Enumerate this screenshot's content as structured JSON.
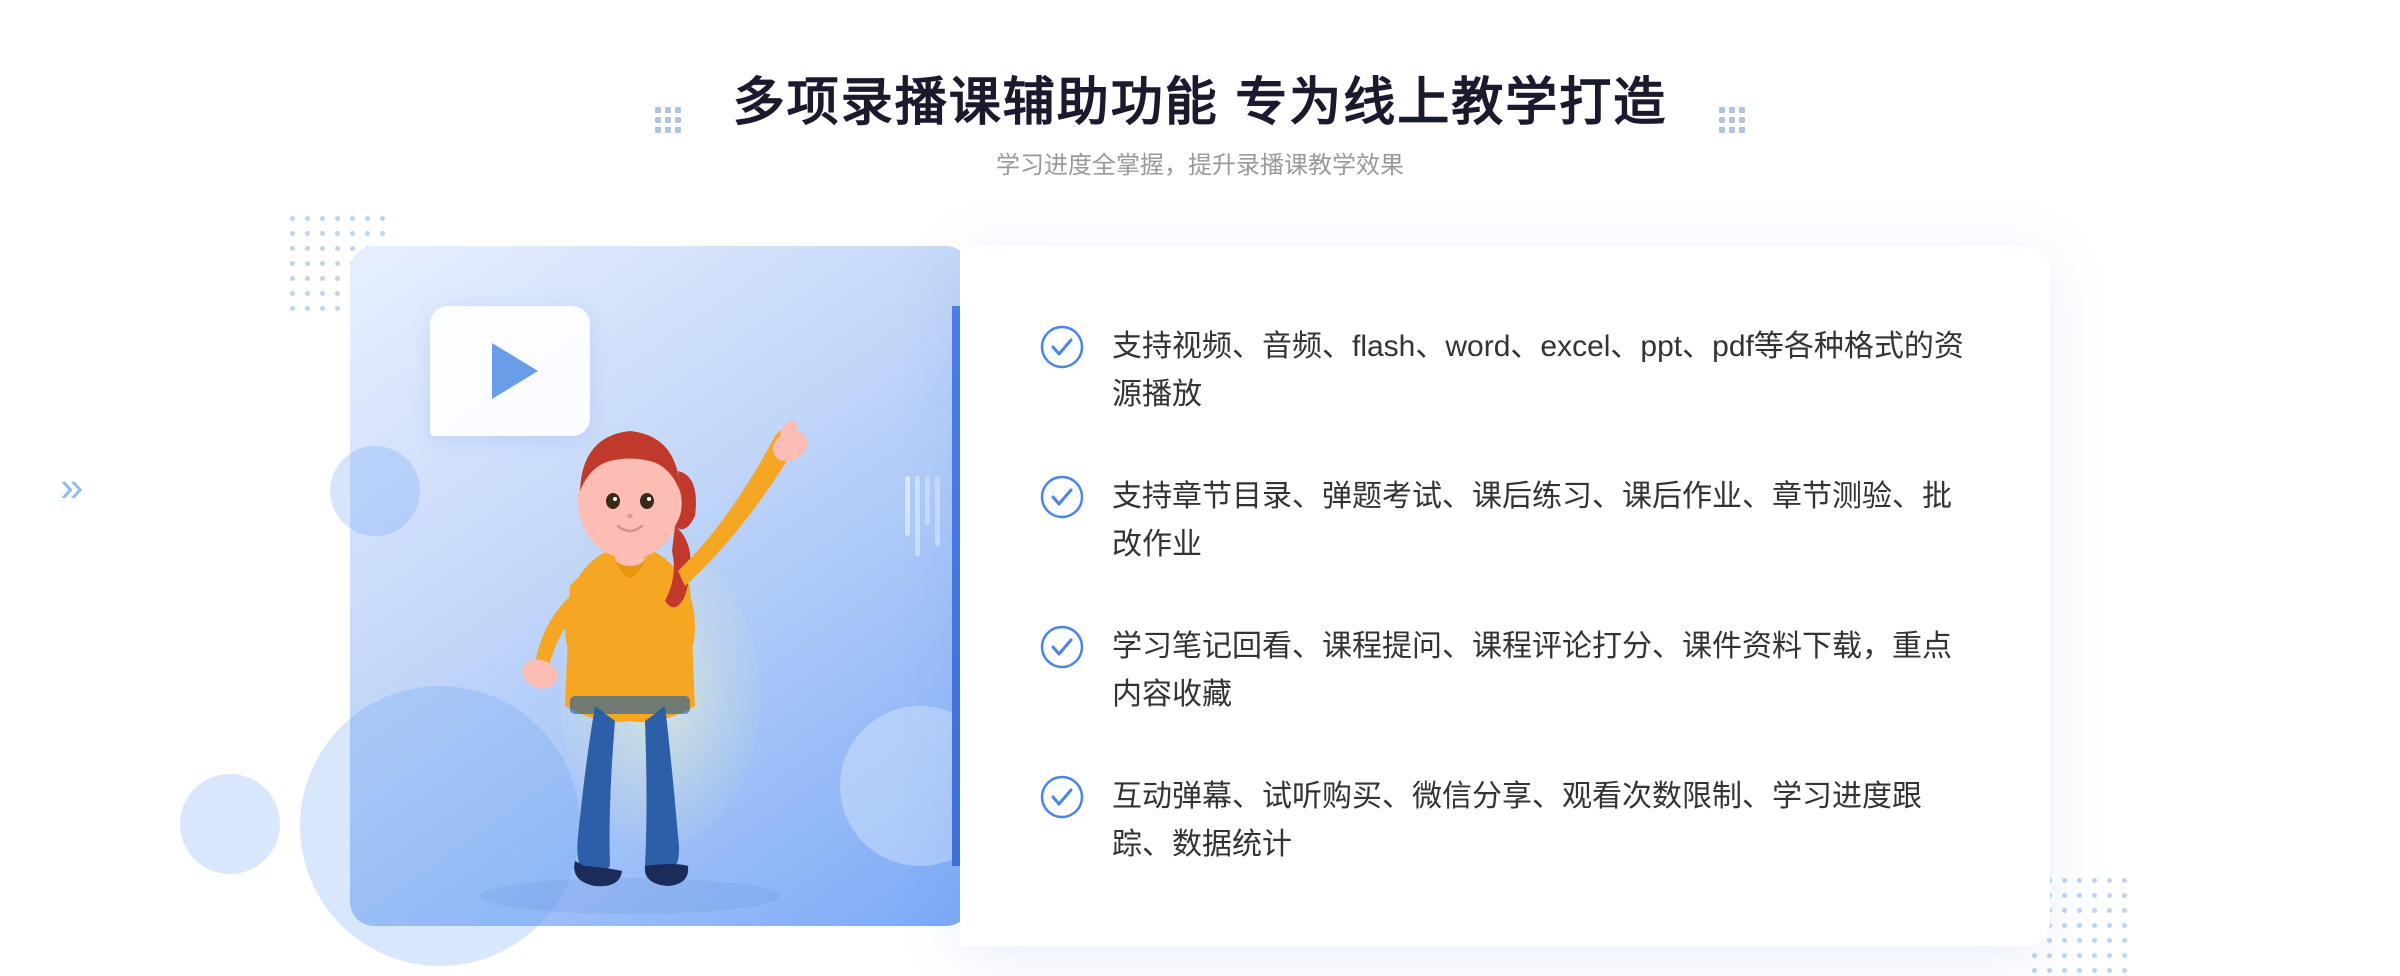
{
  "page": {
    "background": "#ffffff"
  },
  "header": {
    "main_title": "多项录播课辅助功能 专为线上教学打造",
    "sub_title": "学习进度全掌握，提升录播课教学效果"
  },
  "features": [
    {
      "id": "feature-1",
      "text": "支持视频、音频、flash、word、excel、ppt、pdf等各种格式的资源播放"
    },
    {
      "id": "feature-2",
      "text": "支持章节目录、弹题考试、课后练习、课后作业、章节测验、批改作业"
    },
    {
      "id": "feature-3",
      "text": "学习笔记回看、课程提问、课程评论打分、课件资料下载，重点内容收藏"
    },
    {
      "id": "feature-4",
      "text": "互动弹幕、试听购买、微信分享、观看次数限制、学习进度跟踪、数据统计"
    }
  ],
  "icons": {
    "check": "check-circle-icon",
    "chevron_left": "«",
    "chevron_right": "»",
    "play": "play-icon"
  },
  "colors": {
    "primary_blue": "#4a7de8",
    "light_blue": "#7baaf7",
    "text_dark": "#333333",
    "text_gray": "#999999",
    "title_color": "#1a1a2e",
    "check_color": "#4a85e8"
  }
}
